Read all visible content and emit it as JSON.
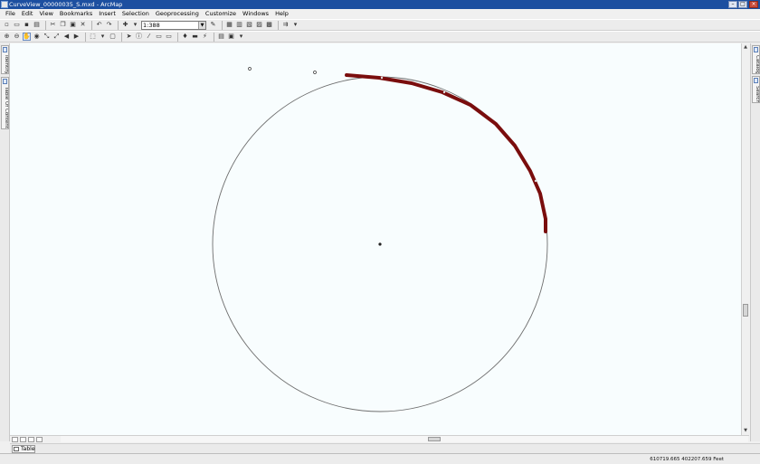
{
  "window": {
    "title": "CurveView_00000035_S.mxd - ArcMap"
  },
  "menu": [
    "File",
    "Edit",
    "View",
    "Bookmarks",
    "Insert",
    "Selection",
    "Geoprocessing",
    "Customize",
    "Windows",
    "Help"
  ],
  "toolbar": {
    "scale": "1:388"
  },
  "left_dock": {
    "tabs": [
      "Identify",
      "Table Of Contents"
    ]
  },
  "right_dock": {
    "tabs": [
      "Catalog",
      "Search"
    ]
  },
  "bottom": {
    "table_tab": "Table"
  },
  "status": {
    "coordinates": "610719.665  402207.659 Feet"
  },
  "colors": {
    "arc": "#7a0d0d",
    "circle": "#6e6e6e",
    "map_background": "#f8fdfe",
    "titlebar": "#1c4fa0"
  }
}
